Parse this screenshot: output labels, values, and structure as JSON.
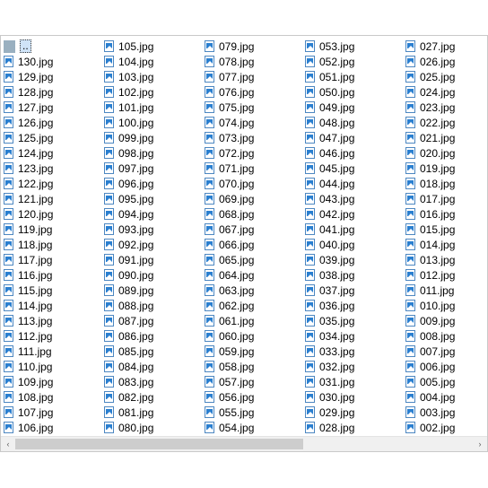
{
  "parent_entry": {
    "label": "..",
    "icon": "folder-up-icon"
  },
  "file_icon": "image-file-icon",
  "files": [
    "130.jpg",
    "129.jpg",
    "128.jpg",
    "127.jpg",
    "126.jpg",
    "125.jpg",
    "124.jpg",
    "123.jpg",
    "122.jpg",
    "121.jpg",
    "120.jpg",
    "119.jpg",
    "118.jpg",
    "117.jpg",
    "116.jpg",
    "115.jpg",
    "114.jpg",
    "113.jpg",
    "112.jpg",
    "111.jpg",
    "110.jpg",
    "109.jpg",
    "108.jpg",
    "107.jpg",
    "106.jpg",
    "105.jpg",
    "104.jpg",
    "103.jpg",
    "102.jpg",
    "101.jpg",
    "100.jpg",
    "099.jpg",
    "098.jpg",
    "097.jpg",
    "096.jpg",
    "095.jpg",
    "094.jpg",
    "093.jpg",
    "092.jpg",
    "091.jpg",
    "090.jpg",
    "089.jpg",
    "088.jpg",
    "087.jpg",
    "086.jpg",
    "085.jpg",
    "084.jpg",
    "083.jpg",
    "082.jpg",
    "081.jpg",
    "080.jpg",
    "079.jpg",
    "078.jpg",
    "077.jpg",
    "076.jpg",
    "075.jpg",
    "074.jpg",
    "073.jpg",
    "072.jpg",
    "071.jpg",
    "070.jpg",
    "069.jpg",
    "068.jpg",
    "067.jpg",
    "066.jpg",
    "065.jpg",
    "064.jpg",
    "063.jpg",
    "062.jpg",
    "061.jpg",
    "060.jpg",
    "059.jpg",
    "058.jpg",
    "057.jpg",
    "056.jpg",
    "055.jpg",
    "054.jpg",
    "053.jpg",
    "052.jpg",
    "051.jpg",
    "050.jpg",
    "049.jpg",
    "048.jpg",
    "047.jpg",
    "046.jpg",
    "045.jpg",
    "044.jpg",
    "043.jpg",
    "042.jpg",
    "041.jpg",
    "040.jpg",
    "039.jpg",
    "038.jpg",
    "037.jpg",
    "036.jpg",
    "035.jpg",
    "034.jpg",
    "033.jpg",
    "032.jpg",
    "031.jpg",
    "030.jpg",
    "029.jpg",
    "028.jpg",
    "027.jpg",
    "026.jpg",
    "025.jpg",
    "024.jpg",
    "023.jpg",
    "022.jpg",
    "021.jpg",
    "020.jpg",
    "019.jpg",
    "018.jpg",
    "017.jpg",
    "016.jpg",
    "015.jpg",
    "014.jpg",
    "013.jpg",
    "012.jpg",
    "011.jpg",
    "010.jpg",
    "009.jpg",
    "008.jpg",
    "007.jpg",
    "006.jpg",
    "005.jpg",
    "004.jpg",
    "003.jpg",
    "002.jpg"
  ],
  "scrollbar": {
    "left_arrow": "‹",
    "right_arrow": "›",
    "thumb_fraction": 0.63,
    "thumb_position": 0.0
  }
}
